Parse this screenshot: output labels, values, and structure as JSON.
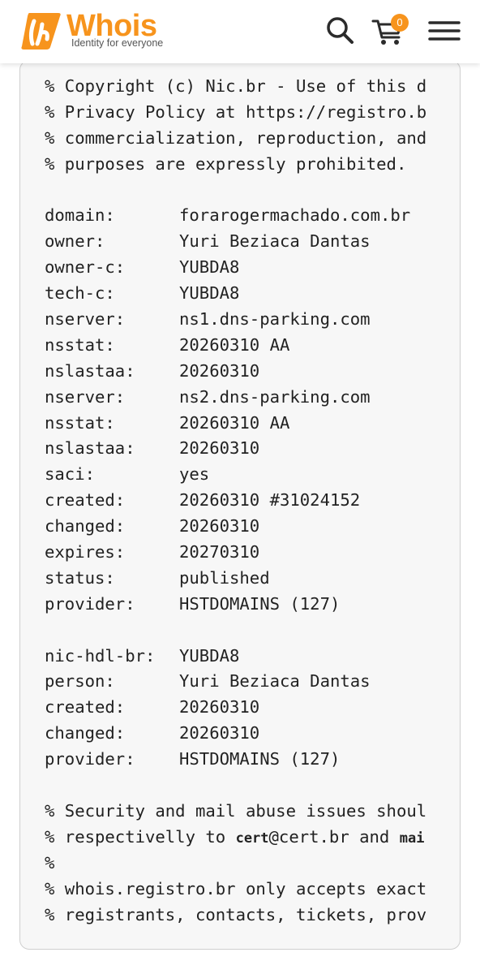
{
  "colors": {
    "brand_orange": "#f7941d",
    "icon_dark": "#2b2b2b",
    "card_bg": "#f7f7f7",
    "card_border": "#cfcfcf",
    "text": "#222222"
  },
  "header": {
    "logo_text": "Whois",
    "tagline": "Identity for everyone",
    "search_icon": "search-icon",
    "cart_icon": "cart-icon",
    "cart_count": "0",
    "menu_icon": "hamburger-menu-icon"
  },
  "whois": {
    "notice_top": [
      "% Copyright (c) Nic.br - Use of this d",
      "% Privacy Policy at https://registro.b",
      "% commercialization, reproduction, and",
      "% purposes are expressly prohibited."
    ],
    "domain_record": [
      {
        "key": "domain:",
        "value": "forarogermachado.com.br"
      },
      {
        "key": "owner:",
        "value": "Yuri Beziaca Dantas"
      },
      {
        "key": "owner-c:",
        "value": "YUBDA8"
      },
      {
        "key": "tech-c:",
        "value": "YUBDA8"
      },
      {
        "key": "nserver:",
        "value": "ns1.dns-parking.com"
      },
      {
        "key": "nsstat:",
        "value": "20260310 AA"
      },
      {
        "key": "nslastaa:",
        "value": "20260310"
      },
      {
        "key": "nserver:",
        "value": "ns2.dns-parking.com"
      },
      {
        "key": "nsstat:",
        "value": "20260310 AA"
      },
      {
        "key": "nslastaa:",
        "value": "20260310"
      },
      {
        "key": "saci:",
        "value": "yes"
      },
      {
        "key": "created:",
        "value": "20260310 #31024152"
      },
      {
        "key": "changed:",
        "value": "20260310"
      },
      {
        "key": "expires:",
        "value": "20270310"
      },
      {
        "key": "status:",
        "value": "published"
      },
      {
        "key": "provider:",
        "value": "HSTDOMAINS (127)"
      }
    ],
    "contact_record": [
      {
        "key": "nic-hdl-br:",
        "value": "YUBDA8"
      },
      {
        "key": "person:",
        "value": "Yuri Beziaca Dantas"
      },
      {
        "key": "created:",
        "value": "20260310"
      },
      {
        "key": "changed:",
        "value": "20260310"
      },
      {
        "key": "provider:",
        "value": "HSTDOMAINS (127)"
      }
    ],
    "notice_bottom": {
      "line1": "% Security and mail abuse issues shoul",
      "line2_prefix": "% respectivelly to ",
      "line2_bold1": "cert",
      "line2_mid": "@cert.br and ",
      "line2_bold2": "mai",
      "line3": "%",
      "line4": "% whois.registro.br only accepts exact",
      "line5": "% registrants, contacts, tickets, prov"
    }
  }
}
